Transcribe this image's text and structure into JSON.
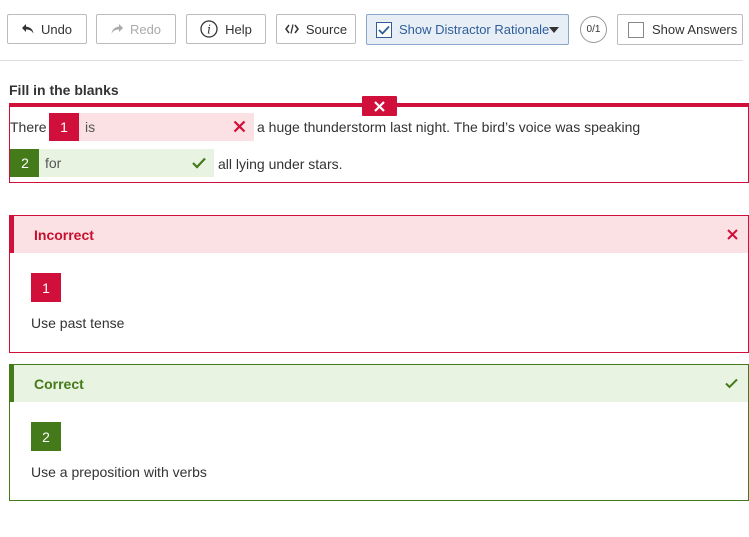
{
  "toolbar": {
    "undo": "Undo",
    "redo": "Redo",
    "help": "Help",
    "source": "Source",
    "distractor": "Show Distractor Rationale",
    "score": "0/1",
    "show_answers": "Show Answers"
  },
  "question": {
    "title": "Fill in the blanks",
    "text_before": "There",
    "text_middle": "a huge thunderstorm last night. The bird’s voice was speaking",
    "text_after": "all lying under stars.",
    "blanks": [
      {
        "number": "1",
        "value": "is",
        "status": "incorrect"
      },
      {
        "number": "2",
        "value": "for",
        "status": "correct"
      }
    ]
  },
  "feedback": {
    "incorrect": {
      "title": "Incorrect",
      "number": "1",
      "message": "Use past tense"
    },
    "correct": {
      "title": "Correct",
      "number": "2",
      "message": "Use a preposition with verbs"
    }
  },
  "colors": {
    "error": "#d0103a",
    "success": "#457a1a",
    "error_bg": "#fbe1e3",
    "success_bg": "#e8f3e2"
  }
}
